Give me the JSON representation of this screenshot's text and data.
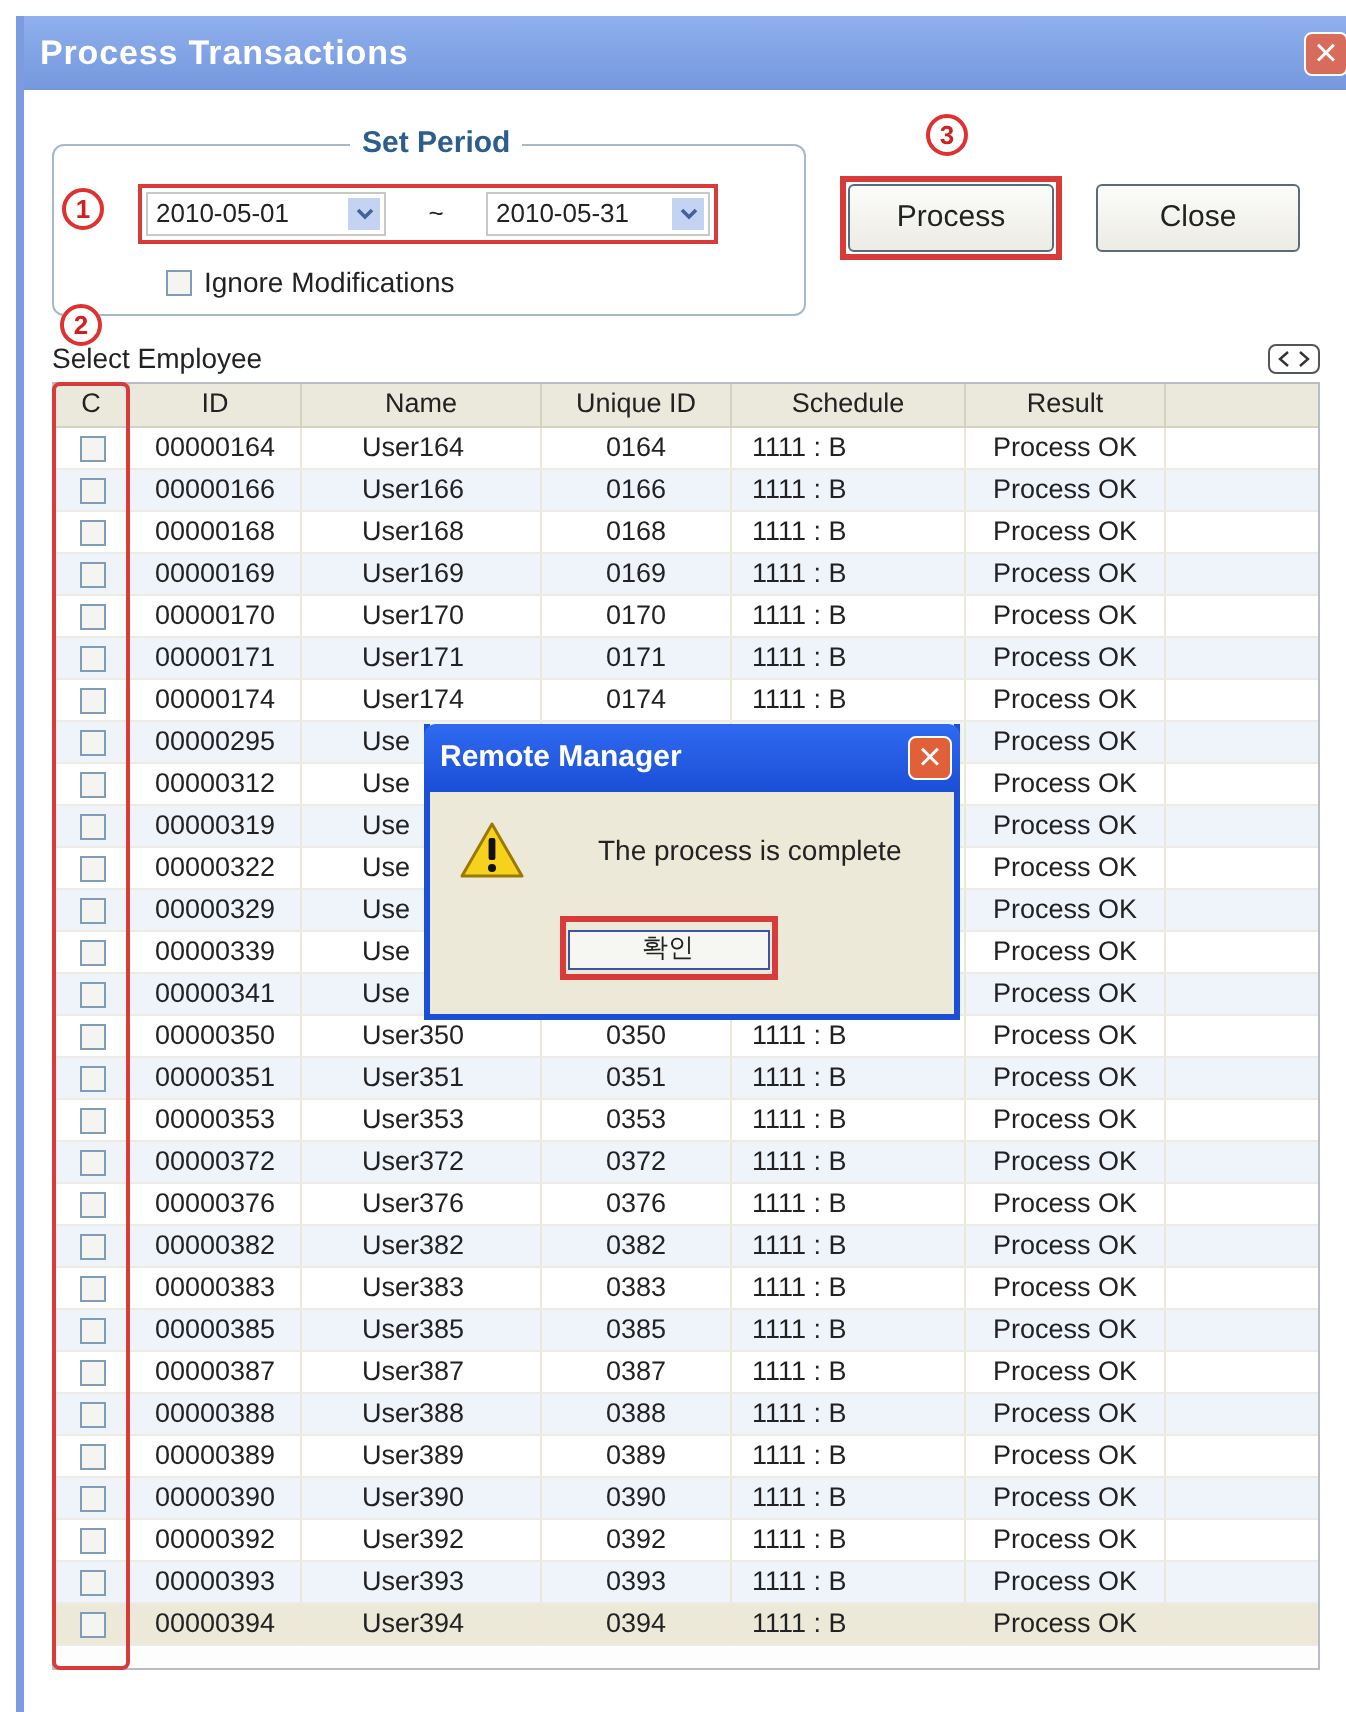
{
  "window": {
    "title": "Process Transactions",
    "close": "×"
  },
  "period": {
    "legend": "Set Period",
    "marker": "1",
    "highlighted": true,
    "from": "2010-05-01",
    "separator": "~",
    "to": "2010-05-31",
    "ignore_modifications": {
      "label": "Ignore Modifications",
      "checked": false
    }
  },
  "buttons": [
    {
      "label": "Process",
      "marker": "3",
      "highlighted": true
    },
    {
      "label": "Close",
      "highlighted": false
    }
  ],
  "employee_section": {
    "label": "Select Employee",
    "marker": "2",
    "check_column_highlighted": true
  },
  "table": {
    "columns": [
      "C",
      "ID",
      "Name",
      "Unique ID",
      "Schedule",
      "Result"
    ],
    "rows": [
      {
        "id": "00000164",
        "name": "User164",
        "unique_id": "0164",
        "schedule": "1111 : B",
        "result": "Process OK",
        "checked": false,
        "selected": false
      },
      {
        "id": "00000166",
        "name": "User166",
        "unique_id": "0166",
        "schedule": "1111 : B",
        "result": "Process OK",
        "checked": false,
        "selected": false
      },
      {
        "id": "00000168",
        "name": "User168",
        "unique_id": "0168",
        "schedule": "1111 : B",
        "result": "Process OK",
        "checked": false,
        "selected": false
      },
      {
        "id": "00000169",
        "name": "User169",
        "unique_id": "0169",
        "schedule": "1111 : B",
        "result": "Process OK",
        "checked": false,
        "selected": false
      },
      {
        "id": "00000170",
        "name": "User170",
        "unique_id": "0170",
        "schedule": "1111 : B",
        "result": "Process OK",
        "checked": false,
        "selected": false
      },
      {
        "id": "00000171",
        "name": "User171",
        "unique_id": "0171",
        "schedule": "1111 : B",
        "result": "Process OK",
        "checked": false,
        "selected": false
      },
      {
        "id": "00000174",
        "name": "User174",
        "unique_id": "0174",
        "schedule": "1111 : B",
        "result": "Process OK",
        "checked": false,
        "selected": false
      },
      {
        "id": "00000295",
        "name": "Use",
        "result": "Process OK",
        "checked": false,
        "selected": false
      },
      {
        "id": "00000312",
        "name": "Use",
        "result": "Process OK",
        "checked": false,
        "selected": false
      },
      {
        "id": "00000319",
        "name": "Use",
        "result": "Process OK",
        "checked": false,
        "selected": false
      },
      {
        "id": "00000322",
        "name": "Use",
        "result": "Process OK",
        "checked": false,
        "selected": false
      },
      {
        "id": "00000329",
        "name": "Use",
        "result": "Process OK",
        "checked": false,
        "selected": false
      },
      {
        "id": "00000339",
        "name": "Use",
        "result": "Process OK",
        "checked": false,
        "selected": false
      },
      {
        "id": "00000341",
        "name": "Use",
        "result": "Process OK",
        "checked": false,
        "selected": false
      },
      {
        "id": "00000350",
        "name": "User350",
        "unique_id": "0350",
        "schedule": "1111 : B",
        "result": "Process OK",
        "checked": false,
        "selected": false
      },
      {
        "id": "00000351",
        "name": "User351",
        "unique_id": "0351",
        "schedule": "1111 : B",
        "result": "Process OK",
        "checked": false,
        "selected": false
      },
      {
        "id": "00000353",
        "name": "User353",
        "unique_id": "0353",
        "schedule": "1111 : B",
        "result": "Process OK",
        "checked": false,
        "selected": false
      },
      {
        "id": "00000372",
        "name": "User372",
        "unique_id": "0372",
        "schedule": "1111 : B",
        "result": "Process OK",
        "checked": false,
        "selected": false
      },
      {
        "id": "00000376",
        "name": "User376",
        "unique_id": "0376",
        "schedule": "1111 : B",
        "result": "Process OK",
        "checked": false,
        "selected": false
      },
      {
        "id": "00000382",
        "name": "User382",
        "unique_id": "0382",
        "schedule": "1111 : B",
        "result": "Process OK",
        "checked": false,
        "selected": false
      },
      {
        "id": "00000383",
        "name": "User383",
        "unique_id": "0383",
        "schedule": "1111 : B",
        "result": "Process OK",
        "checked": false,
        "selected": false
      },
      {
        "id": "00000385",
        "name": "User385",
        "unique_id": "0385",
        "schedule": "1111 : B",
        "result": "Process OK",
        "checked": false,
        "selected": false
      },
      {
        "id": "00000387",
        "name": "User387",
        "unique_id": "0387",
        "schedule": "1111 : B",
        "result": "Process OK",
        "checked": false,
        "selected": false
      },
      {
        "id": "00000388",
        "name": "User388",
        "unique_id": "0388",
        "schedule": "1111 : B",
        "result": "Process OK",
        "checked": false,
        "selected": false
      },
      {
        "id": "00000389",
        "name": "User389",
        "unique_id": "0389",
        "schedule": "1111 : B",
        "result": "Process OK",
        "checked": false,
        "selected": false
      },
      {
        "id": "00000390",
        "name": "User390",
        "unique_id": "0390",
        "schedule": "1111 : B",
        "result": "Process OK",
        "checked": false,
        "selected": false
      },
      {
        "id": "00000392",
        "name": "User392",
        "unique_id": "0392",
        "schedule": "1111 : B",
        "result": "Process OK",
        "checked": false,
        "selected": false
      },
      {
        "id": "00000393",
        "name": "User393",
        "unique_id": "0393",
        "schedule": "1111 : B",
        "result": "Process OK",
        "checked": false,
        "selected": false
      },
      {
        "id": "00000394",
        "name": "User394",
        "unique_id": "0394",
        "schedule": "1111 : B",
        "result": "Process OK",
        "checked": false,
        "selected": true
      }
    ]
  },
  "dialog": {
    "title": "Remote Manager",
    "close": "×",
    "message": "The process is complete",
    "button": {
      "label": "확인",
      "highlighted": true
    }
  }
}
